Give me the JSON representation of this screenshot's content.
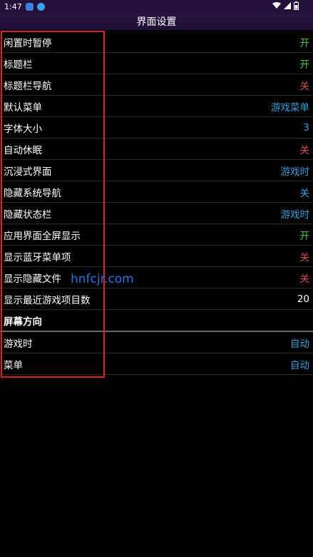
{
  "status_bar": {
    "time": "1:47",
    "app_icons": [
      "app-icon-1",
      "app-icon-2"
    ],
    "system_icons": [
      "wifi-icon",
      "signal-icon",
      "battery-icon"
    ]
  },
  "title": "界面设置",
  "colors": {
    "on": "#4ec04e",
    "off": "#e05050",
    "info": "#3a9fd8",
    "neutral": "#ffffff"
  },
  "settings": [
    {
      "label": "闲置时暂停",
      "value": "开",
      "color": "#4ec04e"
    },
    {
      "label": "标题栏",
      "value": "开",
      "color": "#4ec04e"
    },
    {
      "label": "标题栏导航",
      "value": "关",
      "color": "#e05050"
    },
    {
      "label": "默认菜单",
      "value": "游戏菜单",
      "color": "#3a9fd8"
    },
    {
      "label": "字体大小",
      "value": "3",
      "color": "#3a9fd8"
    },
    {
      "label": "自动休眠",
      "value": "关",
      "color": "#e05050"
    },
    {
      "label": "沉浸式界面",
      "value": "游戏时",
      "color": "#3a9fd8"
    },
    {
      "label": "隐藏系统导航",
      "value": "关",
      "color": "#3a9fd8"
    },
    {
      "label": "隐藏状态栏",
      "value": "游戏时",
      "color": "#3a9fd8"
    },
    {
      "label": "应用界面全屏显示",
      "value": "开",
      "color": "#4ec04e"
    },
    {
      "label": "显示蓝牙菜单项",
      "value": "关",
      "color": "#e05050"
    },
    {
      "label": "显示隐藏文件",
      "value": "关",
      "color": "#e05050"
    },
    {
      "label": "显示最近游戏项目数",
      "value": "20",
      "color": "#ffffff"
    }
  ],
  "orientation_section": {
    "header": "屏幕方向",
    "items": [
      {
        "label": "游戏时",
        "value": "自动",
        "color": "#3a9fd8"
      },
      {
        "label": "菜单",
        "value": "自动",
        "color": "#3a9fd8"
      }
    ]
  },
  "watermark": "hnfcjr.com"
}
